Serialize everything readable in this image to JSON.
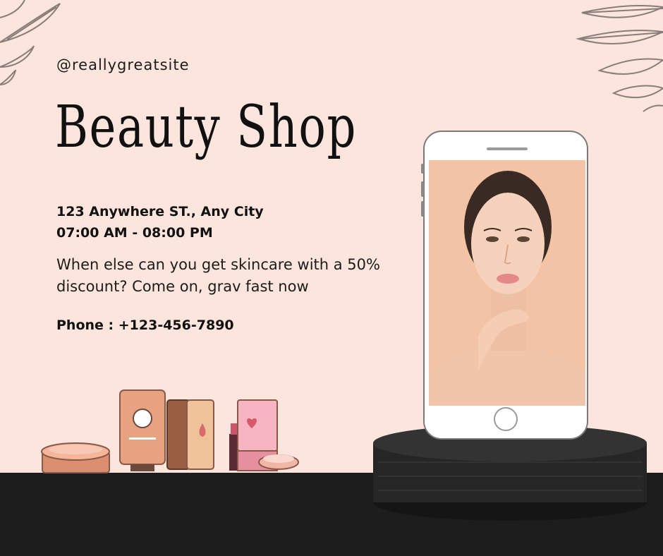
{
  "brand": {
    "handle": "@reallygreatsite",
    "title": "Beauty Shop"
  },
  "info": {
    "address": "123 Anywhere ST., Any City",
    "hours": "07:00 AM - 08:00 PM",
    "description": "When else can you get skincare with a 50% discount? Come on, grav fast now",
    "phone": "Phone : +123-456-7890"
  },
  "colors": {
    "background": "#fbe5dc",
    "floor": "#1d1d1d",
    "podium": "#2a2a2a",
    "text": "#111111",
    "skin": "#f2c3a5"
  },
  "icons": [
    "leaf-icon",
    "smartphone-icon",
    "cosmetics-icon",
    "heart-icon"
  ]
}
